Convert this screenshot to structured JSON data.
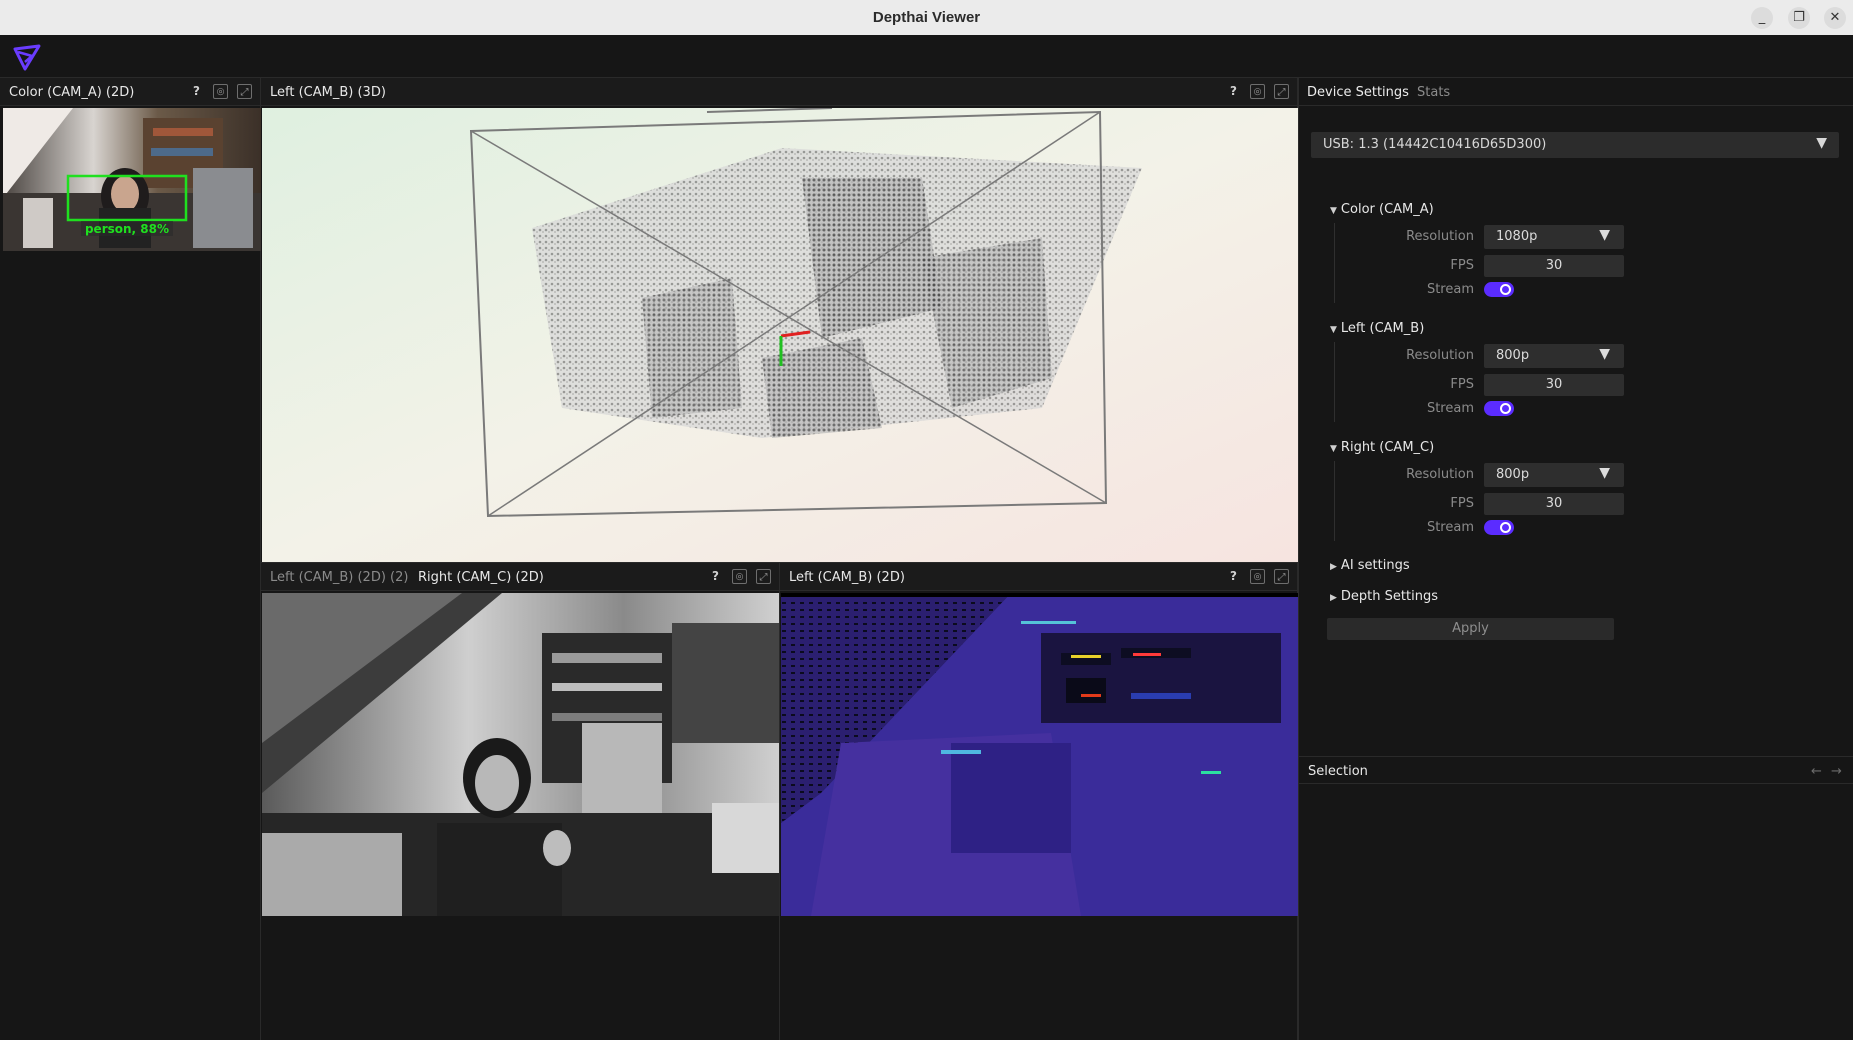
{
  "window": {
    "title": "Depthai Viewer",
    "min": "_",
    "max": "❐",
    "close": "✕"
  },
  "panels": {
    "color": {
      "title": "Color (CAM_A) (2D)",
      "detection_label": "person, 88%"
    },
    "left3d": {
      "title": "Left (CAM_B) (3D)"
    },
    "mono": {
      "tab_inactive": "Left (CAM_B) (2D) (2)",
      "tab_active": "Right (CAM_C) (2D)"
    },
    "depth": {
      "title": "Left (CAM_B) (2D)"
    },
    "help_icon": "?"
  },
  "sidebar": {
    "tabs": [
      "Device Settings",
      "Stats"
    ],
    "device": "USB: 1.3 (14442C10416D65D300)",
    "cameras": [
      {
        "name": "Color (CAM_A)",
        "resolution": "1080p",
        "fps": "30",
        "stream": true
      },
      {
        "name": "Left (CAM_B)",
        "resolution": "800p",
        "fps": "30",
        "stream": true
      },
      {
        "name": "Right (CAM_C)",
        "resolution": "800p",
        "fps": "30",
        "stream": true
      }
    ],
    "labels": {
      "resolution": "Resolution",
      "fps": "FPS",
      "stream": "Stream"
    },
    "ai_settings": "AI settings",
    "depth_settings": "Depth Settings",
    "apply": "Apply",
    "selection": "Selection",
    "accent": "#5b2cff"
  }
}
